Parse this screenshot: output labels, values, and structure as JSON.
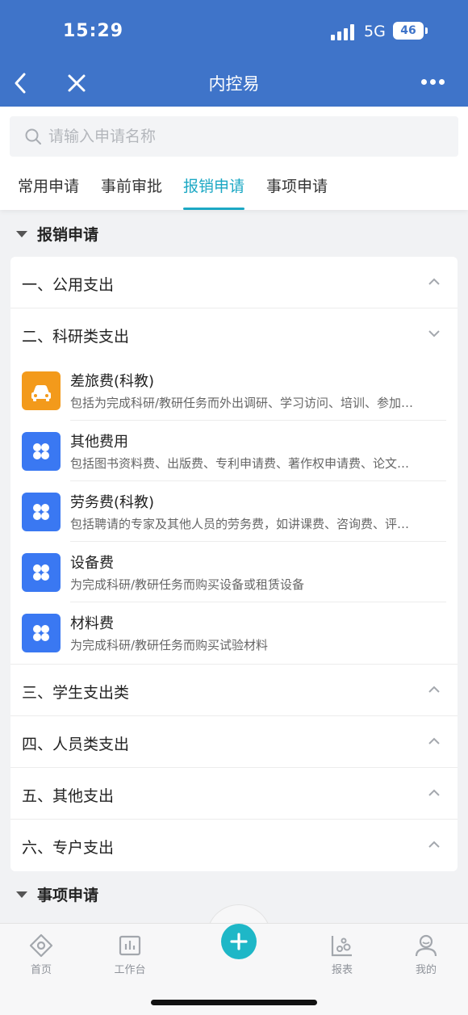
{
  "status_bar": {
    "time": "15:29",
    "network": "5G",
    "battery": "46"
  },
  "nav": {
    "title": "内控易"
  },
  "search": {
    "placeholder": "请输入申请名称"
  },
  "tabs": [
    {
      "label": "常用申请",
      "active": false
    },
    {
      "label": "事前审批",
      "active": false
    },
    {
      "label": "报销申请",
      "active": true
    },
    {
      "label": "事项申请",
      "active": false
    }
  ],
  "section_reimburse": {
    "title": "报销申请"
  },
  "categories": [
    {
      "label": "一、公用支出",
      "expanded": false
    },
    {
      "label": "二、科研类支出",
      "expanded": true
    },
    {
      "label": "三、学生支出类",
      "expanded": false
    },
    {
      "label": "四、人员类支出",
      "expanded": false
    },
    {
      "label": "五、其他支出",
      "expanded": false
    },
    {
      "label": "六、专户支出",
      "expanded": false
    }
  ],
  "research_items": [
    {
      "title": "差旅费(科教)",
      "desc": "包括为完成科研/教研任务而外出调研、学习访问、培训、参加…",
      "icon": "car-icon",
      "color": "#f39a1b"
    },
    {
      "title": "其他费用",
      "desc": "包括图书资料费、出版费、专利申请费、著作权申请费、论文…",
      "icon": "grid-icon",
      "color": "#3a78f2"
    },
    {
      "title": "劳务费(科教)",
      "desc": "包括聘请的专家及其他人员的劳务费，如讲课费、咨询费、评…",
      "icon": "grid-icon",
      "color": "#3a78f2"
    },
    {
      "title": "设备费",
      "desc": "为完成科研/教研任务而购买设备或租赁设备",
      "icon": "grid-icon",
      "color": "#3a78f2"
    },
    {
      "title": "材料费",
      "desc": "为完成科研/教研任务而购买试验材料",
      "icon": "grid-icon",
      "color": "#3a78f2"
    }
  ],
  "section_matters": {
    "title": "事项申请"
  },
  "bottom_nav": {
    "home": "首页",
    "workbench": "工作台",
    "reports": "报表",
    "mine": "我的"
  },
  "colors": {
    "header": "#3f74c9",
    "accent": "#1ca8c4",
    "orange": "#f39a1b",
    "blue": "#3a78f2"
  }
}
